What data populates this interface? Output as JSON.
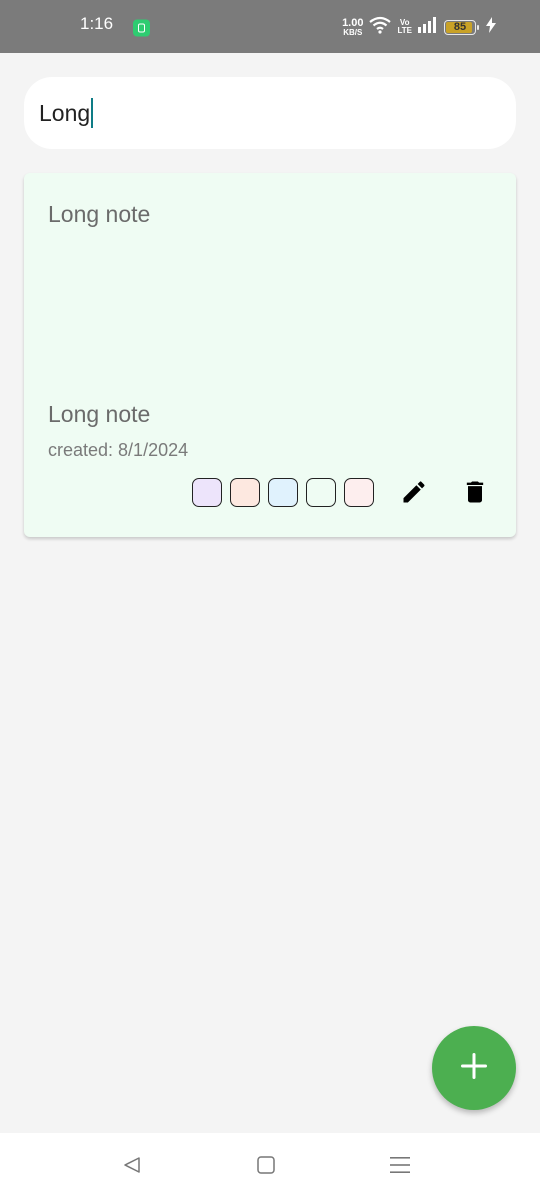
{
  "status_bar": {
    "time": "1:16",
    "net_speed_value": "1.00",
    "net_speed_unit": "KB/S",
    "volte_top": "Vo",
    "volte_bottom": "LTE",
    "battery_level": "85"
  },
  "search": {
    "value": "Long"
  },
  "notes": [
    {
      "title": "Long note",
      "body": "Long note",
      "created": "created: 8/1/2024",
      "background": "#effcf3",
      "color_swatches": [
        "#ede4fb",
        "#fde8e0",
        "#e0f2fd",
        "#effcf3",
        "#fdeeee"
      ]
    }
  ],
  "icons": {
    "app_notification": "app-notification-icon",
    "wifi": "wifi-icon",
    "signal": "signal-icon",
    "battery": "battery-icon",
    "charging": "charging-icon",
    "edit": "pencil-icon",
    "delete": "trash-icon",
    "add": "plus-icon",
    "back": "back-icon",
    "home": "home-icon",
    "recents": "recents-icon"
  },
  "colors": {
    "fab": "#4caf50",
    "caret": "#0e7c86",
    "status_bar": "#7b7b7b",
    "background": "#f4f4f4"
  }
}
